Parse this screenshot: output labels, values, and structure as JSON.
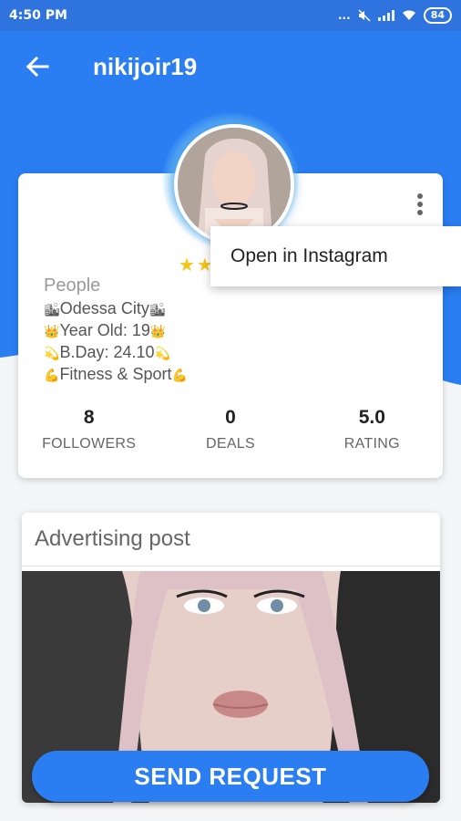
{
  "status_bar": {
    "time": "4:50 PM",
    "dots": "...",
    "battery": "84"
  },
  "app_bar": {
    "title": "nikijoir19",
    "back_icon": "arrow-left-icon"
  },
  "profile": {
    "rating_stars": "★★",
    "category": "People",
    "bio": [
      {
        "pre": "🏙",
        "text": "Odessa City",
        "post": "🏙"
      },
      {
        "pre": "👑",
        "text": "Year Old: 19",
        "post": "👑"
      },
      {
        "pre": "💫",
        "text": "B.Day: 24.10",
        "post": "💫"
      },
      {
        "pre": "💪",
        "text": "Fitness & Sport",
        "post": "💪"
      }
    ],
    "stats": [
      {
        "value": "8",
        "label": "FOLLOWERS"
      },
      {
        "value": "0",
        "label": "DEALS"
      },
      {
        "value": "5.0",
        "label": "RATING"
      }
    ],
    "menu_icon": "more-vertical-icon"
  },
  "popup": {
    "item": "Open in Instagram"
  },
  "ad": {
    "title": "Advertising post"
  },
  "send_button": "SEND REQUEST",
  "colors": {
    "primary": "#2b7ef2",
    "status_bar": "#2f73de",
    "star": "#f4c418"
  }
}
